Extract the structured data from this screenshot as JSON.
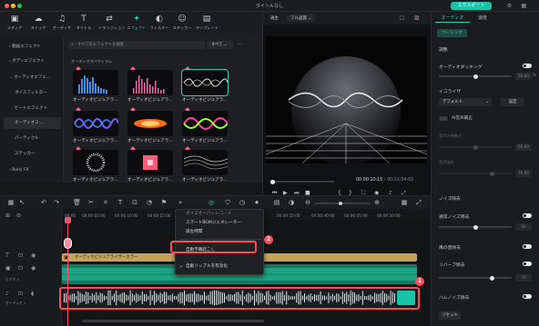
{
  "window": {
    "title": "タイトルなし",
    "export_label": "エクスポート"
  },
  "toolbar": {
    "items": [
      {
        "label": "メディア",
        "icon": "media-icon"
      },
      {
        "label": "ストック",
        "icon": "stock-icon"
      },
      {
        "label": "オーディオ",
        "icon": "audio-icon"
      },
      {
        "label": "タイトル",
        "icon": "title-icon"
      },
      {
        "label": "トランジション",
        "icon": "transition-icon"
      },
      {
        "label": "エフェクト",
        "icon": "effect-icon"
      },
      {
        "label": "フィルター",
        "icon": "filter-icon"
      },
      {
        "label": "ステッカー",
        "icon": "sticker-icon"
      },
      {
        "label": "テンプレート",
        "icon": "template-icon"
      }
    ]
  },
  "sidebar": {
    "items": [
      {
        "label": "動画エフェクト",
        "sub": false
      },
      {
        "label": "ボディエフェクト",
        "sub": false
      },
      {
        "label": "オーディオエフェ...",
        "sub": false
      },
      {
        "label": "ボイスフィルター",
        "sub": true
      },
      {
        "label": "ビートエフェクト",
        "sub": true
      },
      {
        "label": "オーディオス...",
        "sub": true
      },
      {
        "label": "パーティクル",
        "sub": true
      },
      {
        "label": "ステッカー",
        "sub": true
      },
      {
        "label": "Boris FX",
        "sub": false
      }
    ]
  },
  "browser": {
    "search_placeholder": "すべてのエフェクトを検索",
    "filter_label": "すべて",
    "section_label": "オーディオスペクトラム",
    "items": [
      {
        "name": "オーディオビジュアラ..."
      },
      {
        "name": "オーディオビジュアラ..."
      },
      {
        "name": "オーディオビジュアラ..."
      },
      {
        "name": "オーディオビジュアラ..."
      },
      {
        "name": "オーディオビジュアラ..."
      },
      {
        "name": "オーディオビジュアラ..."
      },
      {
        "name": "オーディオビジュアラ..."
      },
      {
        "name": "オーディオビジュアラ..."
      },
      {
        "name": "オーディオビジュアラ..."
      }
    ]
  },
  "preview": {
    "tab_label": "再生",
    "quality": "フル品質",
    "current_time": "00:00:10:15",
    "total_time": "00:11:54:02"
  },
  "inspector": {
    "tabs": [
      "オーディオ",
      "速度"
    ],
    "basic_tab": "ベーシック",
    "adjust_label": "調整",
    "ducking_label": "オーディオダッキング",
    "ducking_value": "50.00",
    "ducking_unit": "%",
    "eq_label": "イコライザ",
    "eq_value": "デフォルト",
    "eq_setting": "設定",
    "ai_voice_label": "AI音声補正",
    "voice_quality_label": "音声の明瞭さ",
    "voice_quality_value": "50.00",
    "voice_enhance_label": "音声強化",
    "voice_enhance_value": "70.00",
    "noise_section": "ノイズ除去",
    "normal_noise_label": "通常ノイズ除去",
    "normal_noise_value": "50",
    "wind_label": "風の音除去",
    "reverb_label": "リバーブ除去",
    "reverb_value": "70",
    "hum_label": "ハムノイズ除去",
    "reset_label": "リセット"
  },
  "timeline": {
    "ruler": [
      "00:00",
      "00:00:05:00",
      "00:00:10:00",
      "00:00:15:00",
      "00:00:20:00",
      "00:00:25:00",
      "00:00:30:00",
      "00:00:35:00",
      "00:00:40:00",
      "00:00:45:00",
      "00:00:50:00"
    ],
    "title_clip": "オーディオビジュアライザーカラー",
    "track_labels": [
      "ビデオ 1",
      "オーディオ 1"
    ]
  },
  "context_menu": {
    "items": [
      {
        "label": "ボイスオーバーレコード",
        "checked": false
      },
      {
        "label": "スマートBGMジェネレーター",
        "checked": false
      },
      {
        "label": "再生時間",
        "checked": false
      },
      {
        "label": "",
        "checked": false
      },
      {
        "label": "自動字幕起こし",
        "checked": false
      },
      {
        "label": "自動リップルを有効化",
        "checked": true
      }
    ]
  },
  "annotations": {
    "badge1": "1",
    "badge2": "2"
  },
  "colors": {
    "accent": "#19c3a8",
    "annotation": "#ff4a5c",
    "title_clip": "#c7a35a",
    "video_clip": "#127a62"
  }
}
